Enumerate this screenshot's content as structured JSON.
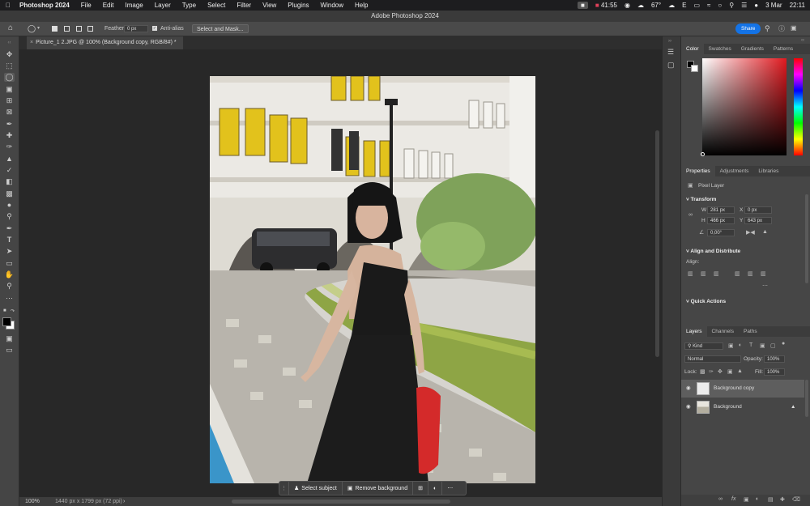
{
  "mac_menu": {
    "app": "Photoshop 2024",
    "items": [
      "File",
      "Edit",
      "Image",
      "Layer",
      "Type",
      "Select",
      "Filter",
      "View",
      "Plugins",
      "Window",
      "Help"
    ],
    "status": {
      "timer": "41:55",
      "temp": "67°",
      "input": "E",
      "date": "3 Mar",
      "time": "22:11"
    }
  },
  "window_title": "Adobe Photoshop 2024",
  "options_bar": {
    "feather_label": "Feather:",
    "feather_value": "0 px",
    "anti_alias_label": "Anti-alias",
    "select_mask_label": "Select and Mask...",
    "share_label": "Share"
  },
  "document_tab": "Picture_1 2.JPG @ 100% (Background copy, RGB/8#) *",
  "status_bar": {
    "zoom": "100%",
    "doc_info": "1440 px x 1799 px (72 ppi)"
  },
  "context_bar": {
    "select_subject": "Select subject",
    "remove_background": "Remove background"
  },
  "color_panel": {
    "tabs": [
      "Color",
      "Swatches",
      "Gradients",
      "Patterns"
    ]
  },
  "properties_panel": {
    "tabs": [
      "Properties",
      "Adjustments",
      "Libraries"
    ],
    "type_label": "Pixel Layer",
    "transform_title": "Transform",
    "w_label": "W",
    "w_value": "281 px",
    "h_label": "H",
    "h_value": "466 px",
    "x_label": "X",
    "x_value": "0 px",
    "y_label": "Y",
    "y_value": "643 px",
    "angle_value": "0,00°",
    "align_title": "Align and Distribute",
    "align_label": "Align:",
    "quick_actions": "Quick Actions"
  },
  "layers_panel": {
    "tabs": [
      "Layers",
      "Channels",
      "Paths"
    ],
    "kind_label": "Kind",
    "blend_mode": "Normal",
    "opacity_label": "Opacity:",
    "opacity_value": "100%",
    "lock_label": "Lock:",
    "fill_label": "Fill:",
    "fill_value": "100%",
    "layers": [
      {
        "name": "Background copy"
      },
      {
        "name": "Background"
      }
    ]
  },
  "colors": {
    "accent": "#1473e6",
    "foreground": "#000000",
    "background": "#ffffff"
  }
}
